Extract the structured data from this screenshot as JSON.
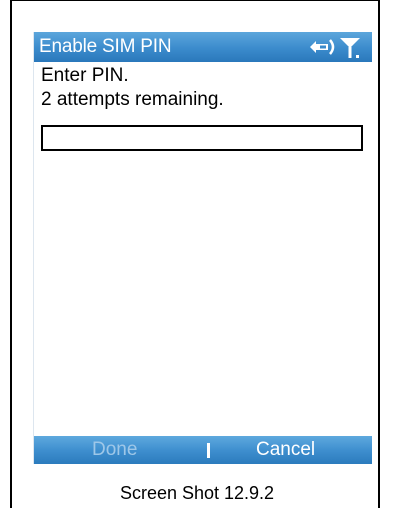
{
  "window": {
    "title": "Enable SIM PIN"
  },
  "status_icons": [
    "connectivity-icon",
    "signal-icon"
  ],
  "prompt": {
    "line1": "Enter PIN.",
    "line2": "2 attempts remaining."
  },
  "pin_field": {
    "value": ""
  },
  "softkeys": {
    "left_label": "Done",
    "left_enabled": false,
    "right_label": "Cancel"
  },
  "caption": "Screen Shot 12.9.2",
  "colors": {
    "titlebar": "#3b8bcc",
    "softkey_disabled": "#9ec7e8",
    "softkey_enabled": "#ffffff"
  }
}
